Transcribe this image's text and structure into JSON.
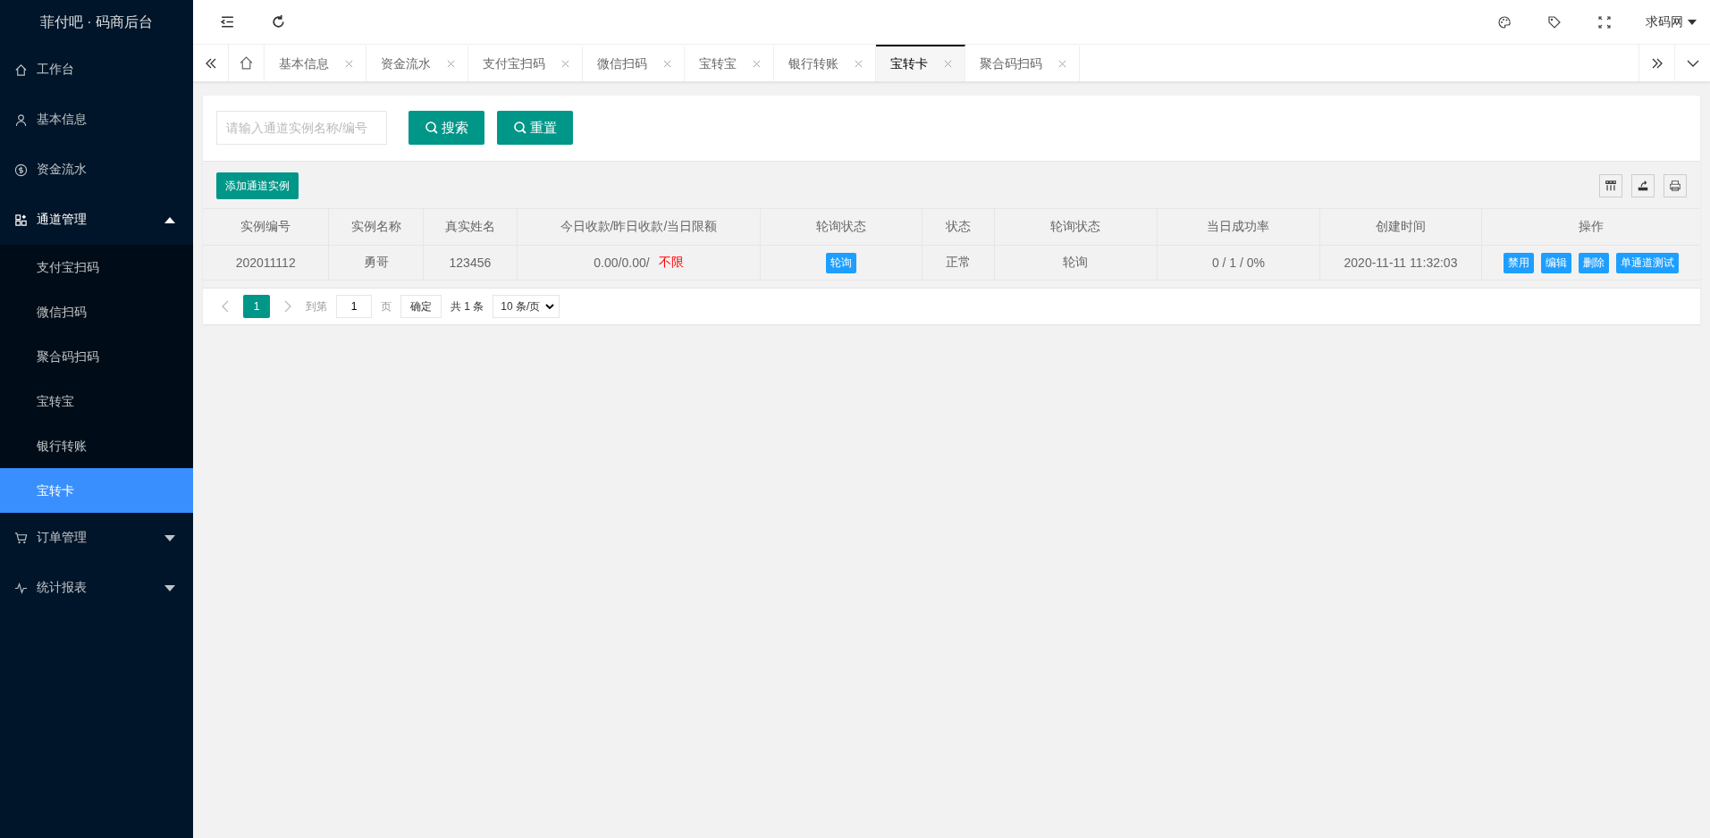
{
  "brand": {
    "title": "菲付吧 · 码商后台"
  },
  "sidebar": {
    "items": [
      {
        "label": "工作台",
        "selected": false
      },
      {
        "label": "基本信息",
        "selected": false
      },
      {
        "label": "资金流水",
        "selected": false
      },
      {
        "label": "通道管理",
        "selected": false,
        "expanded": true,
        "children": [
          {
            "label": "支付宝扫码",
            "selected": false
          },
          {
            "label": "微信扫码",
            "selected": false
          },
          {
            "label": "聚合码扫码",
            "selected": false
          },
          {
            "label": "宝转宝",
            "selected": false
          },
          {
            "label": "银行转账",
            "selected": false
          },
          {
            "label": "宝转卡",
            "selected": true
          }
        ]
      },
      {
        "label": "订单管理",
        "selected": false,
        "expanded": false
      },
      {
        "label": "统计报表",
        "selected": false,
        "expanded": false
      }
    ]
  },
  "header": {
    "user": "求码网"
  },
  "tabs": [
    {
      "label": "基本信息",
      "selected": false
    },
    {
      "label": "资金流水",
      "selected": false
    },
    {
      "label": "支付宝扫码",
      "selected": false
    },
    {
      "label": "微信扫码",
      "selected": false
    },
    {
      "label": "宝转宝",
      "selected": false
    },
    {
      "label": "银行转账",
      "selected": false
    },
    {
      "label": "宝转卡",
      "selected": true
    },
    {
      "label": "聚合码扫码",
      "selected": false
    }
  ],
  "search": {
    "placeholder": "请输入通道实例名称/编号",
    "buttons": [
      "搜索",
      "重置"
    ]
  },
  "toolbar": {
    "add_button": "添加通道实例"
  },
  "table": {
    "columns": [
      "实例编号",
      "实例名称",
      "真实姓名",
      "今日收款/昨日收款/当日限额",
      "轮询状态",
      "状态",
      "轮询状态",
      "当日成功率",
      "创建时间",
      "操作"
    ],
    "rows": [
      [
        {
          "kind": "text",
          "text": "202011112"
        },
        {
          "kind": "text",
          "text": "勇哥"
        },
        {
          "kind": "text",
          "text": "123456"
        },
        {
          "kind": "parts",
          "parts": [
            {
              "text": "0.00/0.00/",
              "alert": false
            },
            {
              "text": "不限",
              "alert": true
            }
          ]
        },
        {
          "kind": "badge",
          "text": "轮询"
        },
        {
          "kind": "text",
          "text": "正常"
        },
        {
          "kind": "text",
          "text": "轮询"
        },
        {
          "kind": "text",
          "text": "0 / 1 / 0%"
        },
        {
          "kind": "text",
          "text": "2020-11-11 11:32:03"
        },
        {
          "kind": "actions",
          "buttons": [
            "禁用",
            "编辑",
            "删除",
            "单通道测试"
          ]
        }
      ]
    ]
  },
  "pager": {
    "pages": [
      {
        "label": "1",
        "selected": true
      }
    ],
    "goto_label": "到第",
    "goto_value": "1",
    "page_unit": "页",
    "confirm": "确定",
    "total": "共 1 条",
    "page_size": "10 条/页"
  }
}
